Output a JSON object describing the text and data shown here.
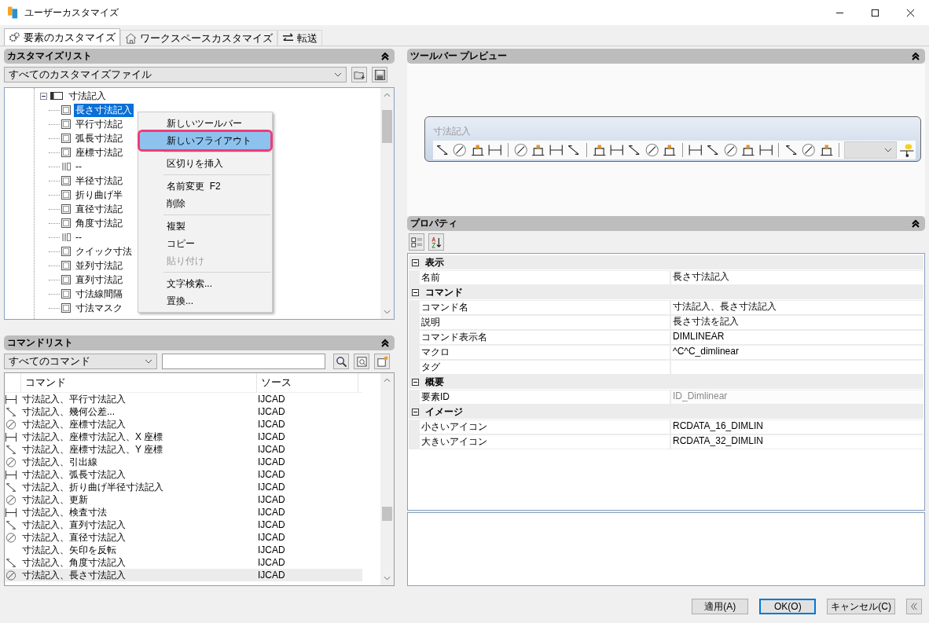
{
  "window": {
    "title": "ユーザーカスタマイズ"
  },
  "tabs": [
    {
      "label": "要素のカスタマイズ",
      "selected": true
    },
    {
      "label": "ワークスペースカスタマイズ",
      "selected": false
    },
    {
      "label": "転送",
      "selected": false
    }
  ],
  "customize_list": {
    "title": "カスタマイズリスト",
    "file_select": "すべてのカスタマイズファイル",
    "tree": {
      "label": "寸法記入",
      "expanded": true,
      "children": [
        {
          "label": "長さ寸法記入",
          "kind": "command",
          "selected": true
        },
        {
          "label": "平行寸法記",
          "kind": "command",
          "selected": false
        },
        {
          "label": "弧長寸法記",
          "kind": "command",
          "selected": false
        },
        {
          "label": "座標寸法記",
          "kind": "command",
          "selected": false
        },
        {
          "label": "--",
          "kind": "separator",
          "selected": false
        },
        {
          "label": "半径寸法記",
          "kind": "command",
          "selected": false
        },
        {
          "label": "折り曲げ半",
          "kind": "command",
          "selected": false
        },
        {
          "label": "直径寸法記",
          "kind": "command",
          "selected": false
        },
        {
          "label": "角度寸法記",
          "kind": "command",
          "selected": false
        },
        {
          "label": "--",
          "kind": "separator",
          "selected": false
        },
        {
          "label": "クイック寸法",
          "kind": "command",
          "selected": false
        },
        {
          "label": "並列寸法記",
          "kind": "command",
          "selected": false
        },
        {
          "label": "直列寸法記",
          "kind": "command",
          "selected": false
        },
        {
          "label": "寸法線間隔",
          "kind": "command",
          "selected": false
        },
        {
          "label": "寸法マスク",
          "kind": "command",
          "selected": false
        }
      ]
    }
  },
  "context_menu": [
    {
      "kind": "item",
      "label": "新しいツールバー",
      "selected": false,
      "disabled": false
    },
    {
      "kind": "item",
      "label": "新しいフライアウト",
      "selected": true,
      "disabled": false
    },
    {
      "kind": "separator"
    },
    {
      "kind": "item",
      "label": "区切りを挿入",
      "selected": false,
      "disabled": false
    },
    {
      "kind": "separator"
    },
    {
      "kind": "item",
      "label": "名前変更",
      "shortcut": "F2",
      "selected": false,
      "disabled": false
    },
    {
      "kind": "item",
      "label": "削除",
      "selected": false,
      "disabled": false
    },
    {
      "kind": "separator"
    },
    {
      "kind": "item",
      "label": "複製",
      "selected": false,
      "disabled": false
    },
    {
      "kind": "item",
      "label": "コピー",
      "selected": false,
      "disabled": false
    },
    {
      "kind": "item",
      "label": "貼り付け",
      "selected": false,
      "disabled": true
    },
    {
      "kind": "separator"
    },
    {
      "kind": "item",
      "label": "文字検索...",
      "selected": false,
      "disabled": false
    },
    {
      "kind": "item",
      "label": "置換...",
      "selected": false,
      "disabled": false
    }
  ],
  "command_list": {
    "title": "コマンドリスト",
    "filter": "すべてのコマンド",
    "columns": [
      "コマンド",
      "ソース"
    ],
    "rows": [
      {
        "command": "寸法記入、平行寸法記入",
        "source": "IJCAD",
        "has_icon": true,
        "selected": false
      },
      {
        "command": "寸法記入、幾何公差...",
        "source": "IJCAD",
        "has_icon": true,
        "selected": false
      },
      {
        "command": "寸法記入、座標寸法記入",
        "source": "IJCAD",
        "has_icon": true,
        "selected": false
      },
      {
        "command": "寸法記入、座標寸法記入、X 座標",
        "source": "IJCAD",
        "has_icon": true,
        "selected": false
      },
      {
        "command": "寸法記入、座標寸法記入、Y 座標",
        "source": "IJCAD",
        "has_icon": true,
        "selected": false
      },
      {
        "command": "寸法記入、引出線",
        "source": "IJCAD",
        "has_icon": true,
        "selected": false
      },
      {
        "command": "寸法記入、弧長寸法記入",
        "source": "IJCAD",
        "has_icon": true,
        "selected": false
      },
      {
        "command": "寸法記入、折り曲げ半径寸法記入",
        "source": "IJCAD",
        "has_icon": true,
        "selected": false
      },
      {
        "command": "寸法記入、更新",
        "source": "IJCAD",
        "has_icon": true,
        "selected": false
      },
      {
        "command": "寸法記入、検査寸法",
        "source": "IJCAD",
        "has_icon": true,
        "selected": false
      },
      {
        "command": "寸法記入、直列寸法記入",
        "source": "IJCAD",
        "has_icon": true,
        "selected": false
      },
      {
        "command": "寸法記入、直径寸法記入",
        "source": "IJCAD",
        "has_icon": true,
        "selected": false
      },
      {
        "command": "寸法記入、矢印を反転",
        "source": "IJCAD",
        "has_icon": false,
        "selected": false
      },
      {
        "command": "寸法記入、角度寸法記入",
        "source": "IJCAD",
        "has_icon": true,
        "selected": false
      },
      {
        "command": "寸法記入、長さ寸法記入",
        "source": "IJCAD",
        "has_icon": true,
        "selected": true
      }
    ]
  },
  "toolbar_preview": {
    "title": "ツールバー プレビュー",
    "toolbar_title": "寸法記入"
  },
  "properties": {
    "title": "プロパティ",
    "categories": [
      {
        "name": "表示",
        "expanded": true,
        "rows": [
          {
            "name": "名前",
            "value": "長さ寸法記入",
            "readonly": false
          }
        ]
      },
      {
        "name": "コマンド",
        "expanded": true,
        "rows": [
          {
            "name": "コマンド名",
            "value": "寸法記入、長さ寸法記入",
            "readonly": false
          },
          {
            "name": "説明",
            "value": "長さ寸法を記入",
            "readonly": false
          },
          {
            "name": "コマンド表示名",
            "value": "DIMLINEAR",
            "readonly": false
          },
          {
            "name": "マクロ",
            "value": "^C^C_dimlinear",
            "readonly": false
          },
          {
            "name": "タグ",
            "readonly": false
          }
        ]
      },
      {
        "name": "概要",
        "expanded": true,
        "rows": [
          {
            "name": "要素ID",
            "value": "ID_Dimlinear",
            "readonly": true
          }
        ]
      },
      {
        "name": "イメージ",
        "expanded": true,
        "rows": [
          {
            "name": "小さいアイコン",
            "value": "RCDATA_16_DIMLIN",
            "readonly": false
          },
          {
            "name": "大きいアイコン",
            "value": "RCDATA_32_DIMLIN",
            "readonly": false
          }
        ]
      }
    ]
  },
  "buttons": [
    {
      "label": "適用(A)",
      "default": false
    },
    {
      "label": "OK(O)",
      "default": true
    },
    {
      "label": "キャンセル(C)",
      "default": false
    }
  ]
}
